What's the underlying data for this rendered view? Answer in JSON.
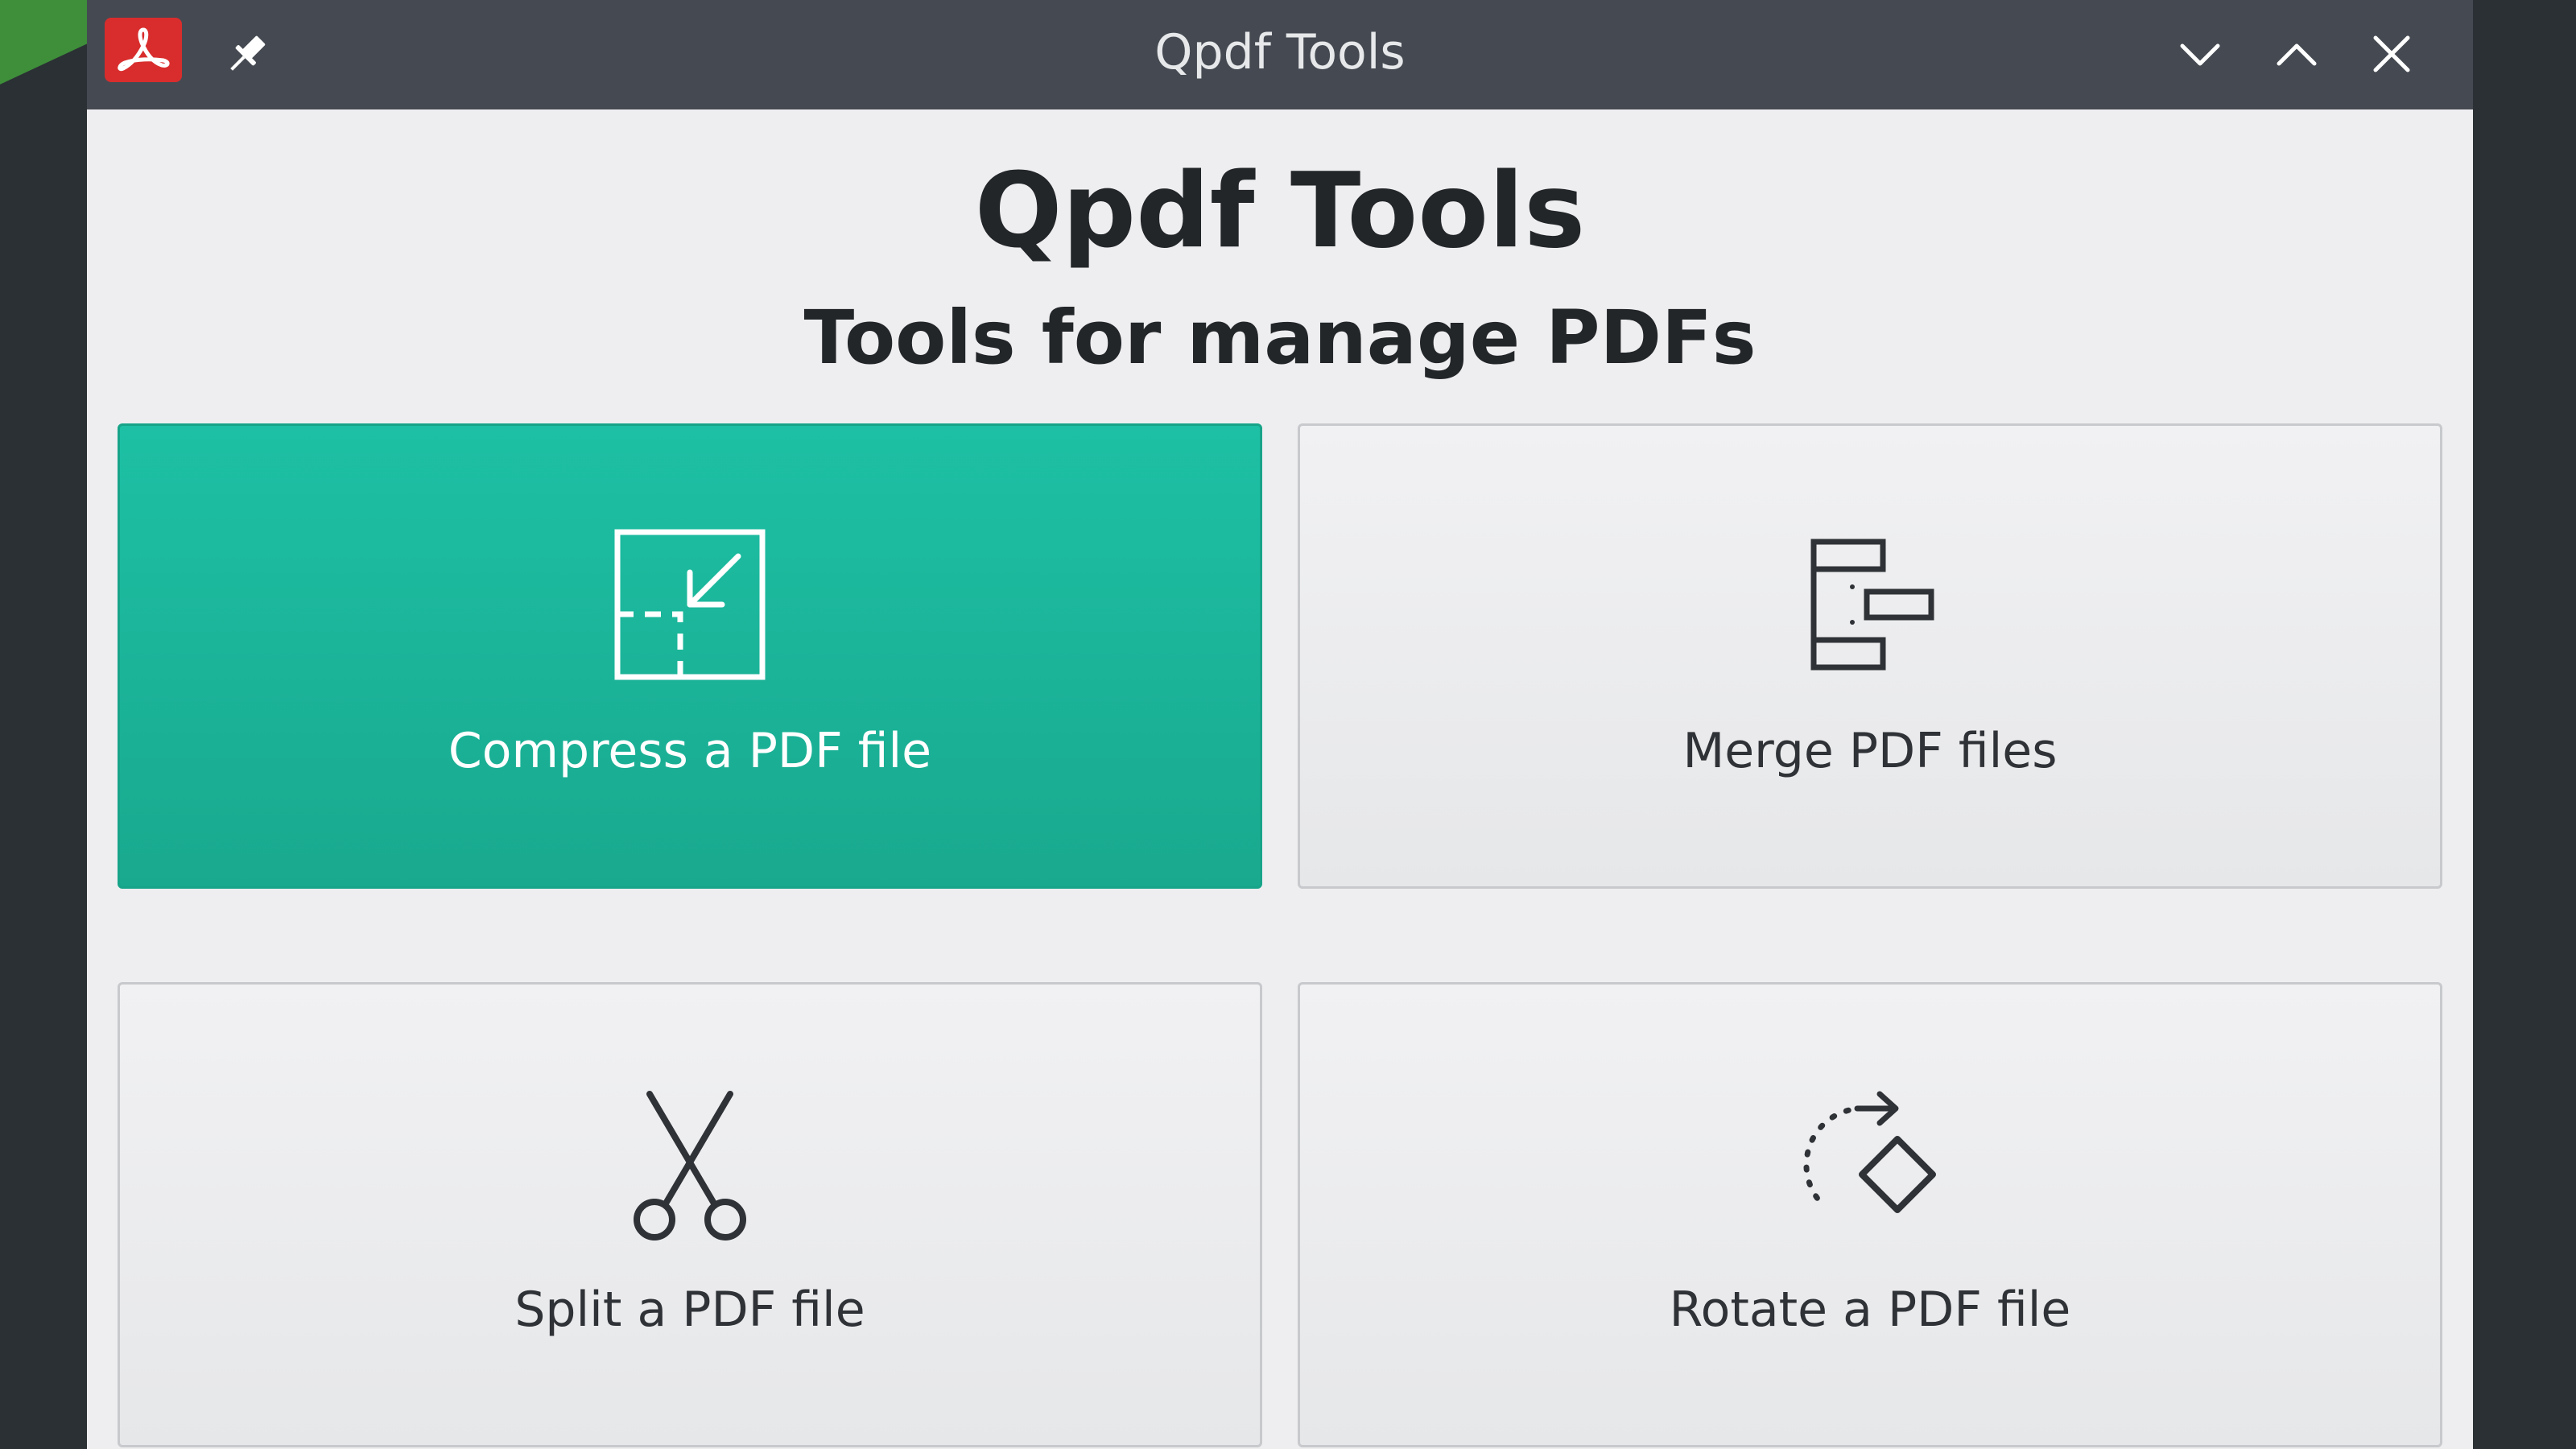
{
  "window": {
    "title": "Qpdf Tools",
    "app_icon": "pdf-icon",
    "controls": [
      "pin-icon",
      "minimize-icon",
      "maximize-icon",
      "close-icon"
    ]
  },
  "header": {
    "title": "Qpdf Tools",
    "subtitle": "Tools for manage PDFs"
  },
  "tools": [
    {
      "label": "Compress a PDF file",
      "icon": "compress-icon",
      "active": true
    },
    {
      "label": "Merge PDF files",
      "icon": "merge-icon",
      "active": false
    },
    {
      "label": "Split a PDF file",
      "icon": "scissors-icon",
      "active": false
    },
    {
      "label": "Rotate a PDF file",
      "icon": "rotate-icon",
      "active": false
    }
  ],
  "colors": {
    "accent": "#1bb89c",
    "titlebar": "#454a52",
    "window_bg": "#eeeef0",
    "pdf_red": "#d92d2d"
  }
}
